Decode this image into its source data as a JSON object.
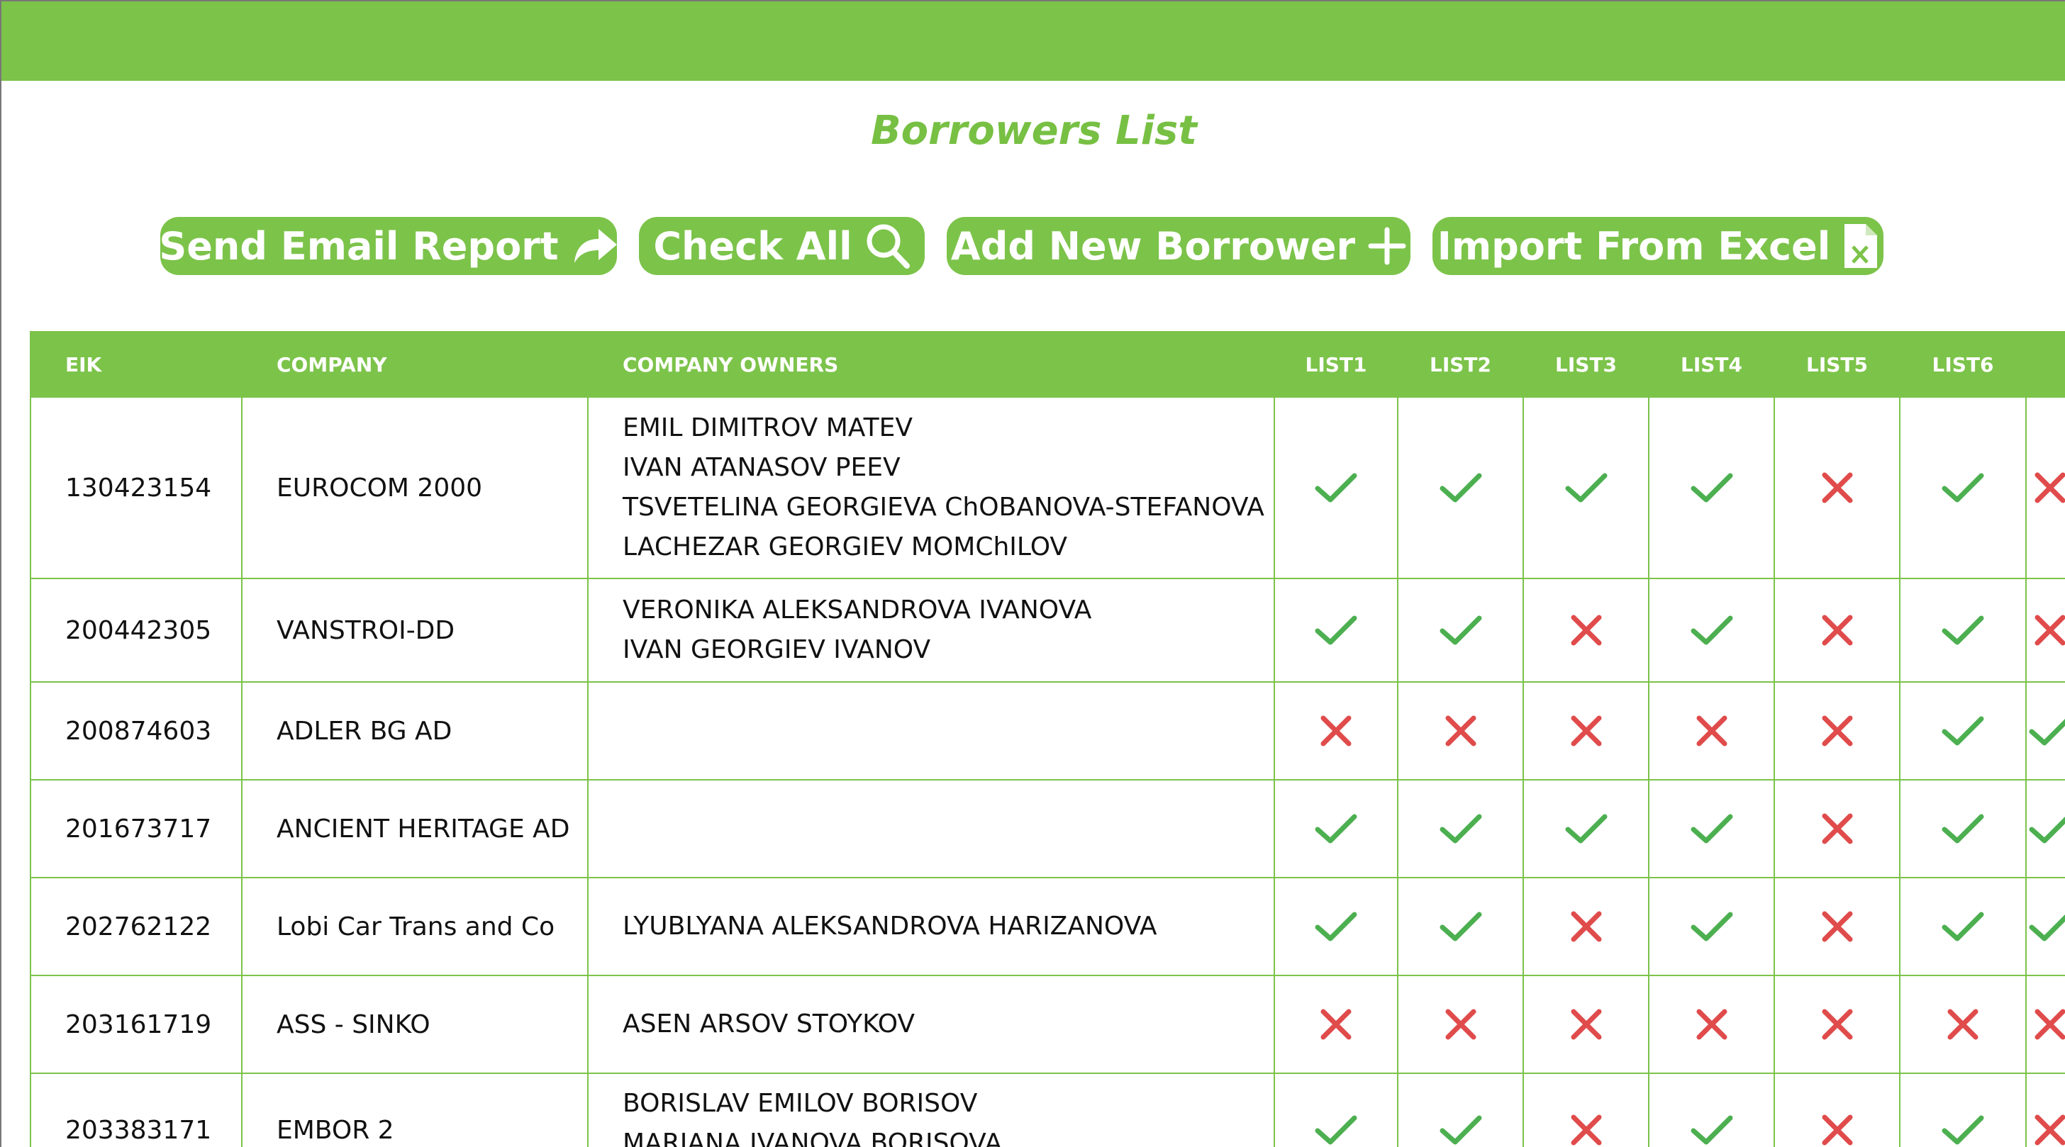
{
  "header": {
    "title": "Borrowers List"
  },
  "toolbar": {
    "send_email": "Send Email Report",
    "check_all": "Check All",
    "add_new": "Add New Borrower",
    "import_excel": "Import From Excel"
  },
  "table": {
    "columns": [
      "EIK",
      "COMPANY",
      "COMPANY OWNERS",
      "LIST1",
      "LIST2",
      "LIST3",
      "LIST4",
      "LIST5",
      "LIST6"
    ],
    "rows": [
      {
        "eik": "130423154",
        "company": "EUROCOM 2000",
        "owners": [
          "EMIL DIMITROV MATEV",
          "IVAN ATANASOV PEEV",
          "TSVETELINA GEORGIEVA ChOBANOVA-STEFANOVA",
          "LACHEZAR GEORGIEV MOMChILOV"
        ],
        "lists": [
          true,
          true,
          true,
          true,
          false,
          true,
          false
        ]
      },
      {
        "eik": "200442305",
        "company": "VANSTROI-DD",
        "owners": [
          "VERONIKA ALEKSANDROVA IVANOVA",
          "IVAN GEORGIEV IVANOV"
        ],
        "lists": [
          true,
          true,
          false,
          true,
          false,
          true,
          false
        ]
      },
      {
        "eik": "200874603",
        "company": "ADLER BG AD",
        "owners": [],
        "lists": [
          false,
          false,
          false,
          false,
          false,
          true,
          true
        ]
      },
      {
        "eik": "201673717",
        "company": "ANCIENT HERITAGE AD",
        "owners": [],
        "lists": [
          true,
          true,
          true,
          true,
          false,
          true,
          true
        ]
      },
      {
        "eik": "202762122",
        "company": "Lobi Car Trans and Co",
        "owners": [
          "LYUBLYANA ALEKSANDROVA HARIZANOVA"
        ],
        "lists": [
          true,
          true,
          false,
          true,
          false,
          true,
          true
        ]
      },
      {
        "eik": "203161719",
        "company": "ASS - SINKO",
        "owners": [
          "ASEN ARSOV STOYKOV"
        ],
        "lists": [
          false,
          false,
          false,
          false,
          false,
          false,
          false
        ]
      },
      {
        "eik": "203383171",
        "company": "EMBOR 2",
        "owners": [
          "BORISLAV EMILOV BORISOV",
          "MARIANA IVANOVA BORISOVA"
        ],
        "lists": [
          true,
          true,
          false,
          true,
          false,
          true,
          false
        ]
      }
    ]
  },
  "colors": {
    "accent": "#7cc34a",
    "check": "#4caf50",
    "cross": "#e04b4b"
  },
  "icons": {
    "send_email": "share-arrow-icon",
    "check_all": "search-icon",
    "add_new": "plus-icon",
    "import_excel": "excel-file-icon",
    "pass": "checkmark-icon",
    "fail": "cross-icon"
  }
}
